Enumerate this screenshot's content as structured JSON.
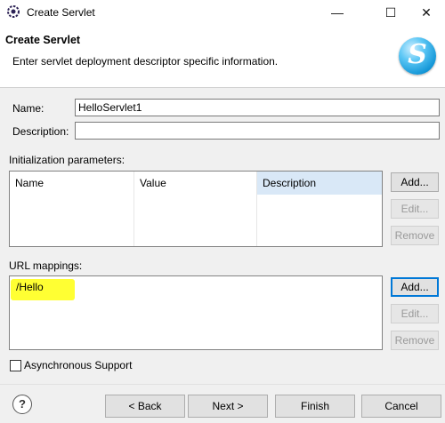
{
  "window": {
    "title": "Create Servlet",
    "minimize": "—",
    "maximize": "☐",
    "close": "✕",
    "app_icon": "eclipse-icon"
  },
  "banner": {
    "title": "Create Servlet",
    "subtitle": "Enter servlet deployment descriptor specific information.",
    "logo_letter": "S"
  },
  "form": {
    "name_label": "Name:",
    "name_value": "HelloServlet1",
    "description_label": "Description:",
    "description_value": ""
  },
  "init_params": {
    "label": "Initialization parameters:",
    "columns": [
      "Name",
      "Value",
      "Description"
    ],
    "add": "Add...",
    "edit": "Edit...",
    "remove": "Remove"
  },
  "url_mappings": {
    "label": "URL mappings:",
    "items": [
      "/Hello"
    ],
    "add": "Add...",
    "edit": "Edit...",
    "remove": "Remove",
    "highlight_color": "#ffff33"
  },
  "async": {
    "label": "Asynchronous Support",
    "checked": false
  },
  "footer": {
    "help": "?",
    "back": "< Back",
    "next": "Next >",
    "finish": "Finish",
    "cancel": "Cancel"
  }
}
